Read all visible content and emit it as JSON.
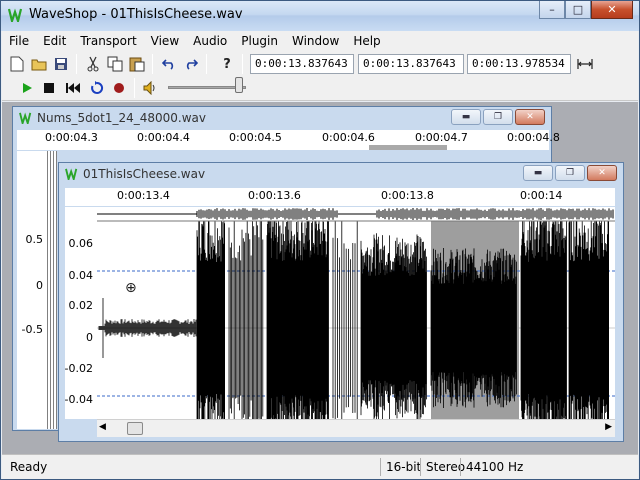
{
  "window": {
    "title": "WaveShop - 01ThisIsCheese.wav",
    "minimize": "–",
    "maximize": "□",
    "close": "✕"
  },
  "menu": [
    "File",
    "Edit",
    "Transport",
    "View",
    "Audio",
    "Plugin",
    "Window",
    "Help"
  ],
  "toolbar": {
    "time_cursor": "0:00:13.837643",
    "time_sel_start": "0:00:13.837643",
    "time_sel_end": "0:00:13.978534",
    "volume_level": 0.9
  },
  "back_window": {
    "title": "Nums_5dot1_24_48000.wav",
    "ruler_ticks": [
      "0:00:04.3",
      "0:00:04.4",
      "0:00:04.5",
      "0:00:04.6",
      "0:00:04.7",
      "0:00:04.8"
    ],
    "y_labels": [
      "0.5",
      "0",
      "-0.5"
    ]
  },
  "front_window": {
    "title": "01ThisIsCheese.wav",
    "ruler_ticks": [
      "0:00:13.4",
      "0:00:13.6",
      "0:00:13.8",
      "0:00:14"
    ],
    "y_labels": [
      "0.06",
      "0.04",
      "0.02",
      "0",
      "-0.02",
      "-0.04"
    ]
  },
  "status": {
    "ready": "Ready",
    "bits": "16-bit",
    "channels": "Stereo",
    "rate": "44100 Hz"
  },
  "colors": {
    "accent_green": "#2aa52a",
    "selection_gray": "#9e9e9e",
    "guide_blue": "#3a6ac8"
  }
}
